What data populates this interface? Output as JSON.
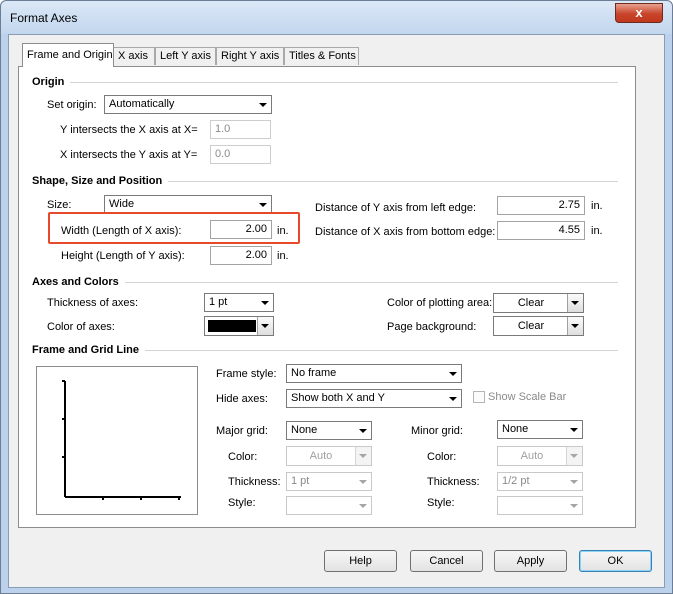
{
  "window": {
    "title": "Format Axes",
    "close_glyph": "x"
  },
  "tabs": [
    {
      "label": "Frame and Origin"
    },
    {
      "label": "X axis"
    },
    {
      "label": "Left Y axis"
    },
    {
      "label": "Right Y axis"
    },
    {
      "label": "Titles & Fonts"
    }
  ],
  "origin": {
    "heading": "Origin",
    "set_origin_label": "Set origin:",
    "set_origin_value": "Automatically",
    "y_intersect_label": "Y intersects the X axis at X=",
    "y_intersect_value": "1.0",
    "x_intersect_label": "X intersects the Y axis at Y=",
    "x_intersect_value": "0.0"
  },
  "shape": {
    "heading": "Shape, Size and Position",
    "size_label": "Size:",
    "size_value": "Wide",
    "width_label": "Width (Length of X axis):",
    "width_value": "2.00",
    "width_unit": "in.",
    "height_label": "Height (Length of Y axis):",
    "height_value": "2.00",
    "height_unit": "in.",
    "dist_y_label": "Distance of Y axis from left edge:",
    "dist_y_value": "2.75",
    "dist_y_unit": "in.",
    "dist_x_label": "Distance of X axis from bottom edge:",
    "dist_x_value": "4.55",
    "dist_x_unit": "in."
  },
  "axes_colors": {
    "heading": "Axes and Colors",
    "thickness_label": "Thickness of axes:",
    "thickness_value": "1 pt",
    "color_label": "Color of axes:",
    "color_value": "#000000",
    "plot_area_label": "Color of plotting area:",
    "plot_area_value": "Clear",
    "page_bg_label": "Page background:",
    "page_bg_value": "Clear"
  },
  "frame_grid": {
    "heading": "Frame and Grid Line",
    "frame_style_label": "Frame style:",
    "frame_style_value": "No frame",
    "hide_axes_label": "Hide axes:",
    "hide_axes_value": "Show both X and Y",
    "show_scale_bar_label": "Show Scale Bar",
    "show_scale_bar_checked": false,
    "major": {
      "label": "Major grid:",
      "value": "None",
      "color_label": "Color:",
      "color_value": "Auto",
      "thickness_label": "Thickness:",
      "thickness_value": "1 pt",
      "style_label": "Style:",
      "style_value": ""
    },
    "minor": {
      "label": "Minor grid:",
      "value": "None",
      "color_label": "Color:",
      "color_value": "Auto",
      "thickness_label": "Thickness:",
      "thickness_value": "1/2 pt",
      "style_label": "Style:",
      "style_value": ""
    }
  },
  "buttons": {
    "help": "Help",
    "cancel": "Cancel",
    "apply": "Apply",
    "ok": "OK"
  },
  "colors": {
    "highlight": "#e64a2b",
    "ok_border": "#3c7fb1"
  }
}
